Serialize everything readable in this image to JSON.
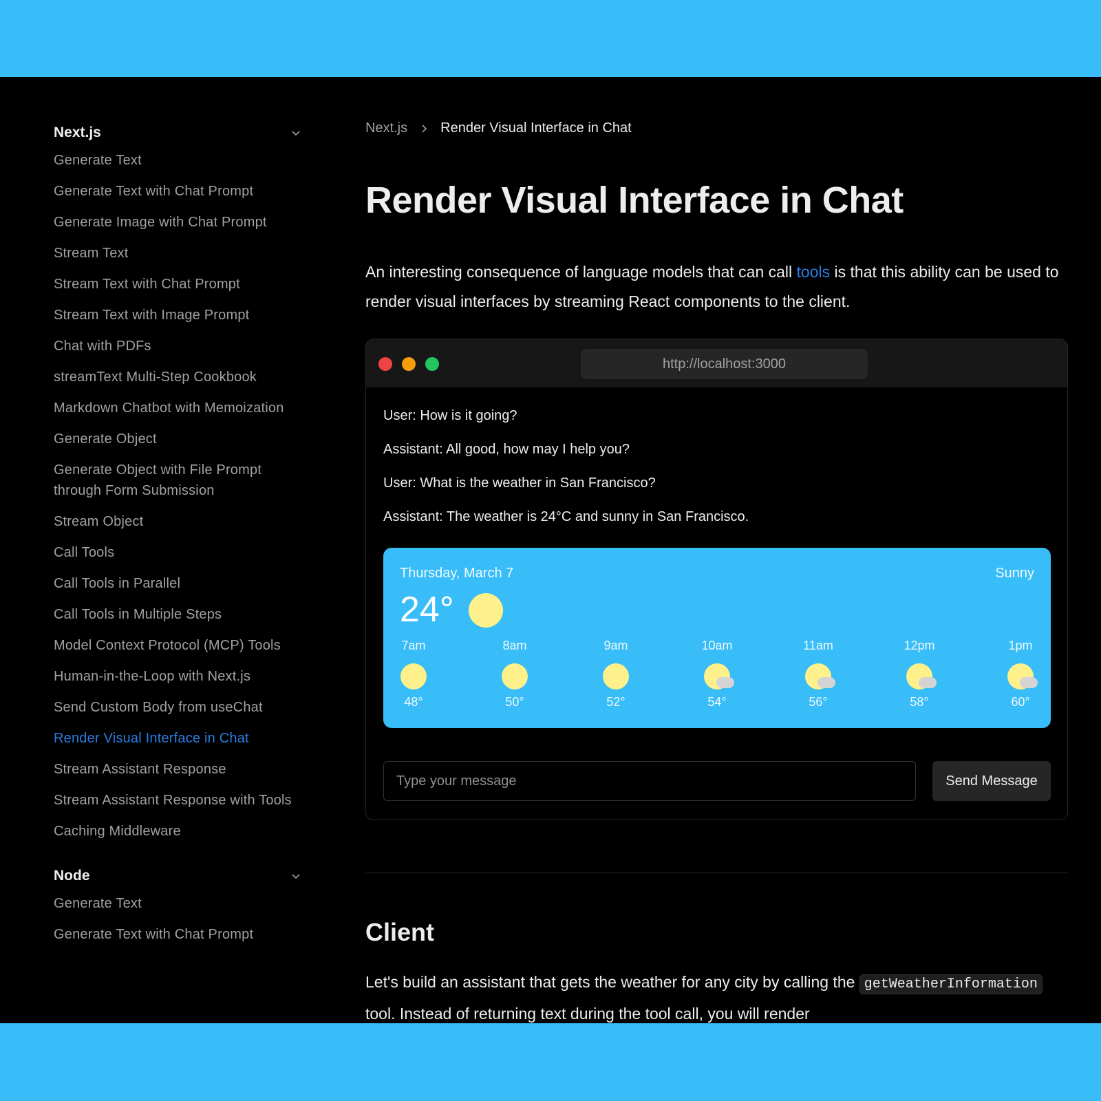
{
  "sidebar": {
    "sections": [
      {
        "title": "Next.js",
        "items": [
          "Generate Text",
          "Generate Text with Chat Prompt",
          "Generate Image with Chat Prompt",
          "Stream Text",
          "Stream Text with Chat Prompt",
          "Stream Text with Image Prompt",
          "Chat with PDFs",
          "streamText Multi-Step Cookbook",
          "Markdown Chatbot with Memoization",
          "Generate Object",
          "Generate Object with File Prompt through Form Submission",
          "Stream Object",
          "Call Tools",
          "Call Tools in Parallel",
          "Call Tools in Multiple Steps",
          "Model Context Protocol (MCP) Tools",
          "Human-in-the-Loop with Next.js",
          "Send Custom Body from useChat",
          "Render Visual Interface in Chat",
          "Stream Assistant Response",
          "Stream Assistant Response with Tools",
          "Caching Middleware"
        ],
        "active": "Render Visual Interface in Chat"
      },
      {
        "title": "Node",
        "items": [
          "Generate Text",
          "Generate Text with Chat Prompt"
        ]
      }
    ]
  },
  "breadcrumb": {
    "parent": "Next.js",
    "current": "Render Visual Interface in Chat"
  },
  "page": {
    "title": "Render Visual Interface in Chat",
    "intro_before": "An interesting consequence of language models that can call ",
    "intro_link": "tools",
    "intro_after": " is that this ability can be used to render visual interfaces by streaming React components to the client."
  },
  "demo": {
    "url": "http://localhost:3000",
    "messages": [
      "User: How is it going?",
      "Assistant: All good, how may I help you?",
      "User: What is the weather in San Francisco?",
      "Assistant: The weather is 24°C and sunny in San Francisco."
    ],
    "weather": {
      "date": "Thursday, March 7",
      "condition": "Sunny",
      "temp": "24°",
      "hours": [
        {
          "time": "7am",
          "temp": "48°",
          "icon": "sun-icon"
        },
        {
          "time": "8am",
          "temp": "50°",
          "icon": "sun-icon"
        },
        {
          "time": "9am",
          "temp": "52°",
          "icon": "sun-icon"
        },
        {
          "time": "10am",
          "temp": "54°",
          "icon": "partly-cloudy-icon"
        },
        {
          "time": "11am",
          "temp": "56°",
          "icon": "partly-cloudy-icon"
        },
        {
          "time": "12pm",
          "temp": "58°",
          "icon": "partly-cloudy-icon"
        },
        {
          "time": "1pm",
          "temp": "60°",
          "icon": "partly-cloudy-icon"
        }
      ]
    },
    "input_placeholder": "Type your message",
    "send_label": "Send Message"
  },
  "client": {
    "heading": "Client",
    "text_before": "Let's build an assistant that gets the weather for any city by calling the ",
    "code": "getWeatherInformation",
    "text_after": " tool. Instead of returning text during the tool call, you will render"
  },
  "colors": {
    "accent": "#2a7de1",
    "weather_card": "#38bdf8",
    "sun": "#fef08a",
    "background": "#000000"
  }
}
